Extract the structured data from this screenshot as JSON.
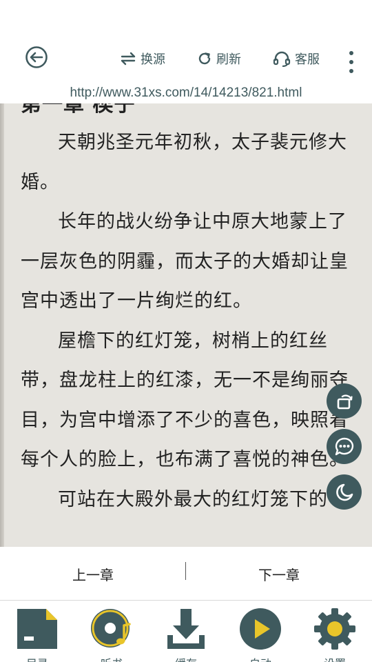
{
  "header": {
    "back_icon": "back-circle-icon",
    "source_label": "换源",
    "refresh_label": "刷新",
    "service_label": "客服",
    "more_icon": "more-vertical-icon",
    "url": "http://www.31xs.com/14/14213/821.html"
  },
  "reader": {
    "heading": "第一章 楔子",
    "paragraphs": [
      "天朝兆圣元年初秋，太子裴元修大婚。",
      "长年的战火纷争让中原大地蒙上了一层灰色的阴霾，而太子的大婚却让皇宫中透出了一片绚烂的红。",
      "屋檐下的红灯笼，树梢上的红丝带，盘龙柱上的红漆，无一不是绚丽夺目，为宫中增添了不少的喜色，映照着每个人的脸上，也布满了喜悦的神色。",
      "可站在大殿外最大的红灯笼下的"
    ],
    "background_color": "#e6e4df"
  },
  "floating": {
    "rotate_icon": "rotate-screen-icon",
    "comment_icon": "comment-icon",
    "night_icon": "night-mode-icon"
  },
  "chapter_nav": {
    "prev_label": "上一章",
    "next_label": "下一章"
  },
  "bottom_bar": {
    "items": [
      {
        "label": "目录",
        "icon": "catalog-icon"
      },
      {
        "label": "听书",
        "icon": "listen-icon"
      },
      {
        "label": "缓存",
        "icon": "download-icon"
      },
      {
        "label": "自动",
        "icon": "autoplay-icon"
      },
      {
        "label": "设置",
        "icon": "settings-icon"
      }
    ]
  },
  "colors": {
    "accent": "#3f5a5e",
    "highlight": "#e9c52a"
  }
}
